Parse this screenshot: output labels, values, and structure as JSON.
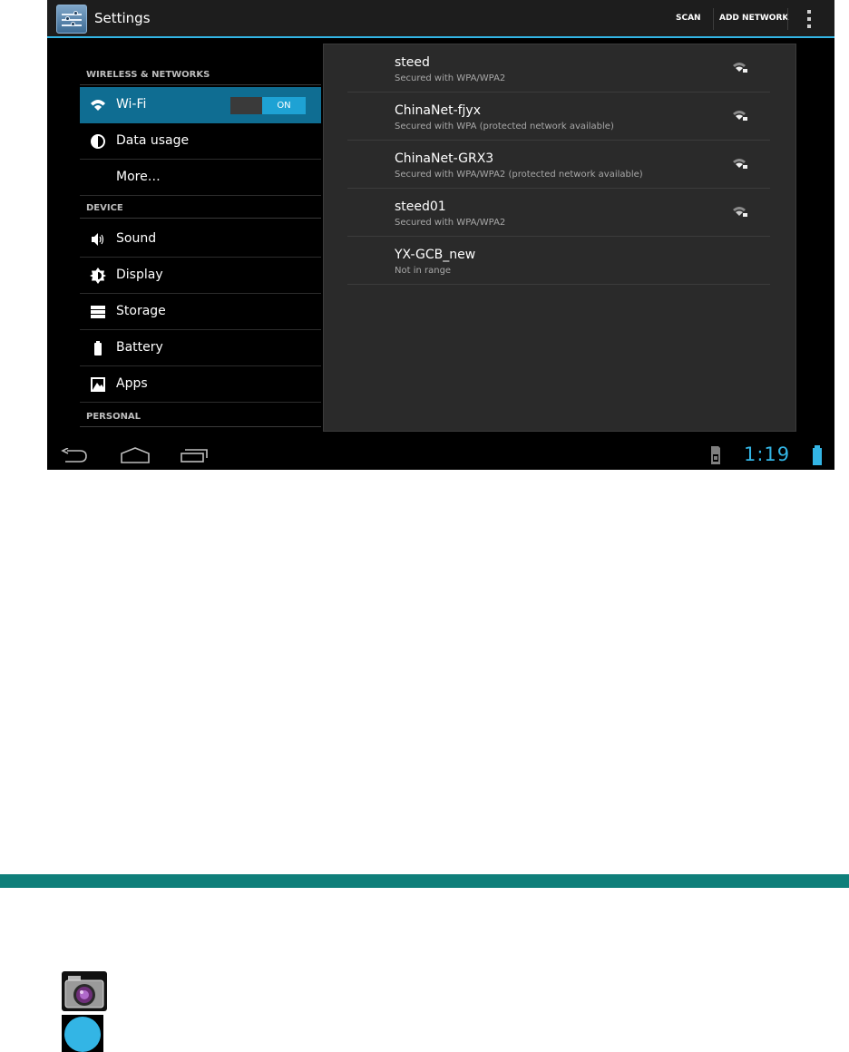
{
  "action_bar": {
    "title": "Settings",
    "actions": [
      "SCAN",
      "ADD NETWORK"
    ],
    "accent_color": "#33b5e5"
  },
  "sidebar": {
    "sections": [
      {
        "header": "WIRELESS & NETWORKS"
      },
      {
        "header": "DEVICE"
      },
      {
        "header": "PERSONAL"
      }
    ],
    "items": [
      {
        "label": "Wi-Fi",
        "icon": "wifi-icon",
        "selected": true,
        "toggle": "ON"
      },
      {
        "label": "Data usage",
        "icon": "data-usage-icon"
      },
      {
        "label": "More…",
        "icon": ""
      },
      {
        "label": "Sound",
        "icon": "speaker-icon"
      },
      {
        "label": "Display",
        "icon": "brightness-icon"
      },
      {
        "label": "Storage",
        "icon": "storage-icon"
      },
      {
        "label": "Battery",
        "icon": "battery-icon"
      },
      {
        "label": "Apps",
        "icon": "apps-icon"
      }
    ]
  },
  "networks": [
    {
      "name": "steed",
      "status": "Secured with WPA/WPA2",
      "signal_icon": "wifi-lock-icon"
    },
    {
      "name": "ChinaNet-fjyx",
      "status": "Secured with WPA (protected network available)",
      "signal_icon": "wifi-lock-icon"
    },
    {
      "name": "ChinaNet-GRX3",
      "status": "Secured with WPA/WPA2 (protected network available)",
      "signal_icon": "wifi-lock-icon"
    },
    {
      "name": "steed01",
      "status": "Secured with WPA/WPA2",
      "signal_icon": "wifi-lock-icon"
    },
    {
      "name": "YX-GCB_new",
      "status": "Not in range",
      "signal_icon": ""
    }
  ],
  "nav_bar": {
    "clock": "1:19",
    "buttons": [
      "back-icon",
      "home-icon",
      "recent-apps-icon"
    ],
    "status_icons": [
      "sd-card-icon",
      "battery-icon"
    ]
  },
  "page": {
    "band_color": "#0f7f7a",
    "icons": [
      "camera-icon",
      "blue-circle-icon"
    ]
  }
}
